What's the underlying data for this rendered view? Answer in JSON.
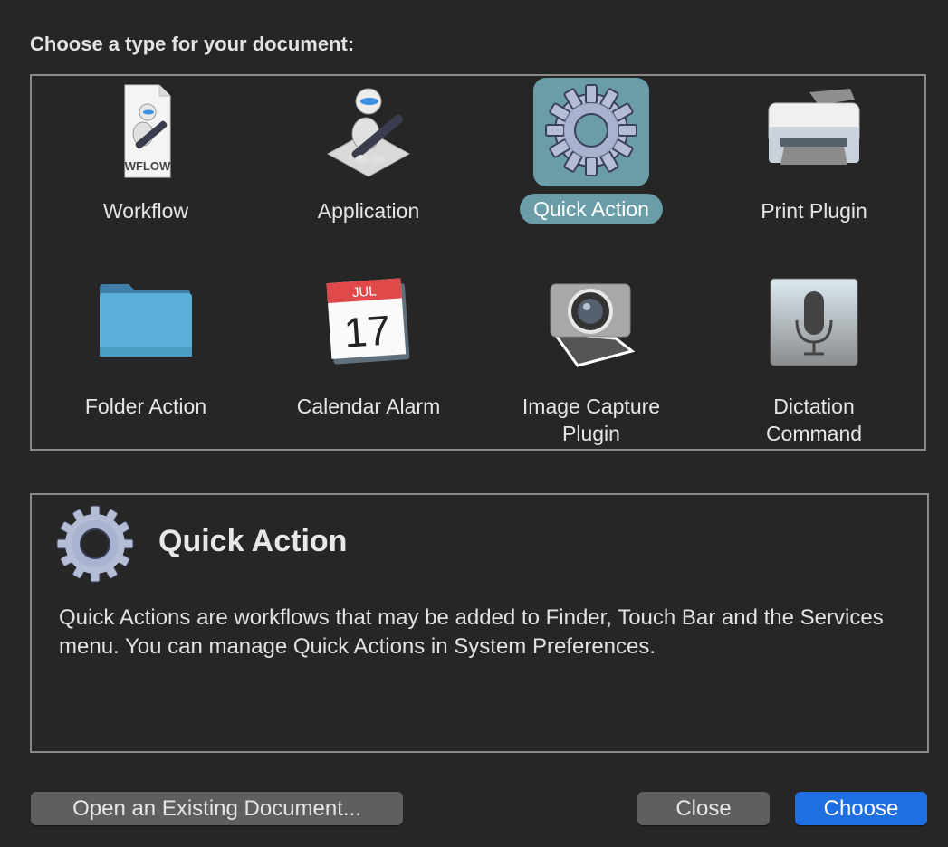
{
  "dialog": {
    "heading": "Choose a type for your document:",
    "types": [
      {
        "label": "Workflow",
        "icon": "workflow-file-icon",
        "badge": "WFLOW",
        "selected": false
      },
      {
        "label": "Application",
        "icon": "automator-app-icon",
        "selected": false
      },
      {
        "label": "Quick Action",
        "icon": "gear-icon",
        "selected": true
      },
      {
        "label": "Print Plugin",
        "icon": "printer-icon",
        "selected": false
      },
      {
        "label": "Folder Action",
        "icon": "folder-icon",
        "selected": false
      },
      {
        "label": "Calendar Alarm",
        "icon": "calendar-icon",
        "month": "JUL",
        "day": "17",
        "selected": false
      },
      {
        "label": "Image Capture\nPlugin",
        "icon": "camera-icon",
        "selected": false
      },
      {
        "label": "Dictation\nCommand",
        "icon": "microphone-icon",
        "selected": false
      }
    ],
    "description": {
      "title": "Quick Action",
      "text": "Quick Actions are workflows that may be added to Finder, Touch Bar and the Services menu. You can manage Quick Actions in System Preferences."
    },
    "buttons": {
      "open_existing": "Open an Existing Document...",
      "close": "Close",
      "choose": "Choose"
    },
    "colors": {
      "selection": "#6a9da8",
      "primary_button": "#1f6fe0",
      "background": "#262626"
    }
  }
}
